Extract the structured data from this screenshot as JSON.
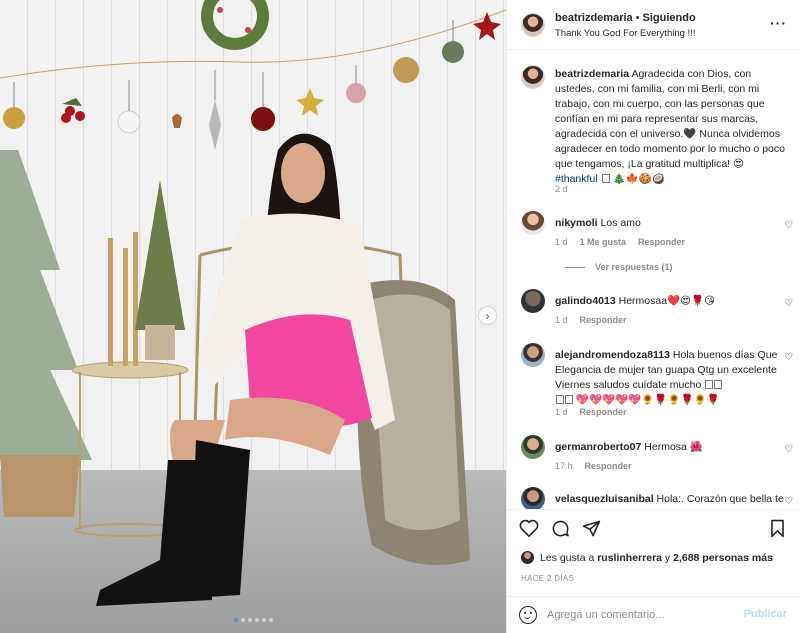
{
  "post": {
    "header": {
      "username": "beatrizdemaria",
      "separator": "•",
      "follow_status": "Siguiendo",
      "subtitle": "Thank You God For Everything !!!"
    },
    "caption": {
      "username": "beatrizdemaria",
      "text": "Agradecida con Dios, con ustedes, con mi familia, con mi Berli, con mi trabajo, con mi cuerpo, con las personas que confían en mi para representar sus marcas, agradecida con el universo.🖤 Nunca olvidemos agradecer en todo momento por lo mucho o poco que tengamos, ¡La gratitud multiplica! 😍",
      "hashtag": "#thankful",
      "emojis": "🎄🍁🍪🥥",
      "time": "2 d"
    },
    "comments": [
      {
        "username": "nikymoli",
        "text": "Los amo",
        "time": "1 d",
        "likes": "1 Me gusta",
        "reply": "Responder",
        "view_replies": "Ver respuestas (1)"
      },
      {
        "username": "galindo4013",
        "text": "Hermosaa❤️😍🌹😘",
        "time": "1 d",
        "reply": "Responder"
      },
      {
        "username": "alejandromendoza8113",
        "text": "Hola buenos días Que Elegancia de mujer tan guapa Qtg un excelente Viernes saludos cuídate mucho",
        "text_extra": "💖💖💖💖💖🌻🌹🌻🌹🌻🌹",
        "time": "1 d",
        "reply": "Responder"
      },
      {
        "username": "germanroberto07",
        "text": "Hermosa 🌺",
        "time": "17 h",
        "reply": "Responder"
      },
      {
        "username": "velasquezluisanibal",
        "text": "Hola:. Corazón que bella te ves y hoy a la mañana más",
        "time": "",
        "reply": ""
      }
    ],
    "likes": {
      "prefix": "Les gusta a",
      "user": "ruslinherrera",
      "mid": "y",
      "count": "2,688 personas más"
    },
    "date": "HACE 2 DÍAS",
    "add_comment": {
      "placeholder": "Agrega un comentario...",
      "publish": "Publicar"
    },
    "carousel": {
      "slides": 6,
      "active": 1
    }
  },
  "icons": {
    "more": "more-options-icon",
    "like": "heart-icon",
    "comment": "comment-bubble-icon",
    "share": "paper-plane-icon",
    "save": "bookmark-icon",
    "emoji": "emoji-icon",
    "next": "chevron-right-icon"
  },
  "colors": {
    "link": "#00376b",
    "muted": "#8e8e8e",
    "publish_disabled": "#b2dffc",
    "carousel_active": "#3897f0",
    "skirt": "#f2479f"
  }
}
